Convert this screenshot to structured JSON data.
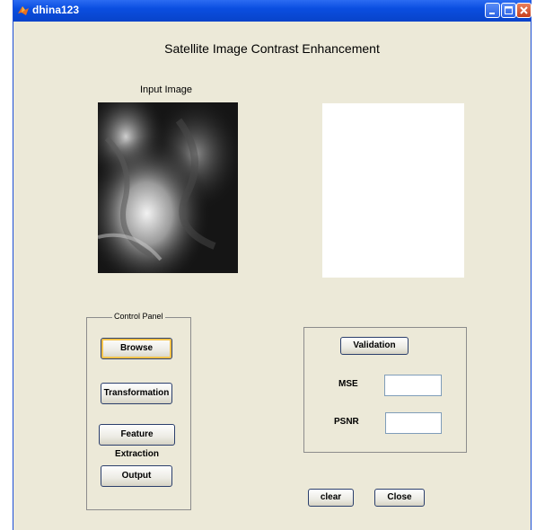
{
  "window": {
    "title": "dhina123",
    "accent": "#0a4ee0",
    "background": "#ece9d8"
  },
  "heading": "Satellite Image Contrast Enhancement",
  "input_image_label": "Input Image",
  "control_panel": {
    "title": "Control Panel",
    "buttons": {
      "browse": "Browse",
      "transformation": "Transformation",
      "feature_extraction": "Feature Extraction",
      "output": "Output"
    }
  },
  "validation": {
    "button": "Validation",
    "mse_label": "MSE",
    "mse_value": "",
    "psnr_label": "PSNR",
    "psnr_value": ""
  },
  "footer": {
    "clear": "clear",
    "close": "Close"
  },
  "icons": [
    "matlab-icon",
    "minimize-icon",
    "maximize-icon",
    "close-icon"
  ]
}
